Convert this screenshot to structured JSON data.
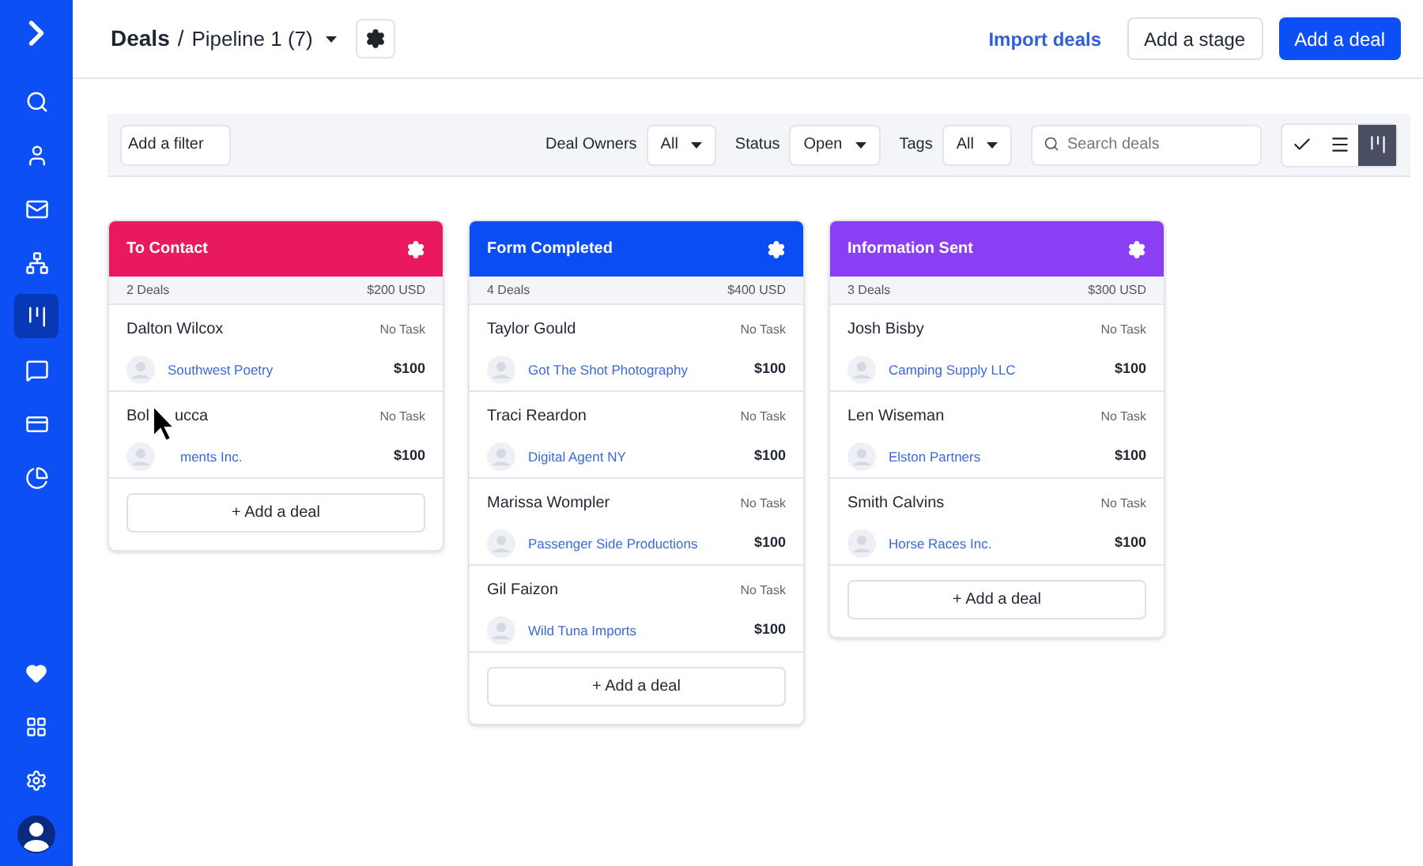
{
  "sidebar": {
    "items": [
      {
        "selected": false
      },
      {
        "selected": false
      },
      {
        "selected": false
      },
      {
        "selected": false
      },
      {
        "selected": true
      },
      {
        "selected": false
      },
      {
        "selected": false
      },
      {
        "selected": false
      }
    ]
  },
  "header": {
    "title": "Deals",
    "separator": "/",
    "pipeline": "Pipeline 1 (7)",
    "import_link": "Import deals",
    "add_stage": "Add a stage",
    "add_deal": "Add a deal"
  },
  "filters": {
    "add_filter": "Add a filter",
    "dropdowns": [
      {
        "label": "Deal Owners",
        "value": "All"
      },
      {
        "label": "Status",
        "value": "Open"
      },
      {
        "label": "Tags",
        "value": "All"
      }
    ],
    "search": {
      "placeholder": "Search deals"
    },
    "views": [
      {
        "selected": false
      },
      {
        "selected": false
      },
      {
        "selected": true
      }
    ]
  },
  "stages": [
    {
      "title": "To Contact",
      "color": "#e8195f",
      "count": "2 Deals",
      "total": "$200 USD",
      "add": "+ Add a deal",
      "deals": [
        {
          "name": "Dalton Wilcox",
          "task": "No Task",
          "company": "Southwest Poetry",
          "amount": "$100"
        },
        {
          "name": "Bol",
          "name_tail": "ucca",
          "task": "No Task",
          "company": "ments Inc.",
          "amount": "$100",
          "cursor": true
        }
      ]
    },
    {
      "title": "Form Completed",
      "color": "#0a4df2",
      "count": "4 Deals",
      "total": "$400 USD",
      "add": "+ Add a deal",
      "deals": [
        {
          "name": "Taylor Gould",
          "task": "No Task",
          "company": "Got The Shot Photography",
          "amount": "$100"
        },
        {
          "name": "Traci Reardon",
          "task": "No Task",
          "company": "Digital Agent NY",
          "amount": "$100"
        },
        {
          "name": "Marissa Wompler",
          "task": "No Task",
          "company": "Passenger Side Productions",
          "amount": "$100"
        },
        {
          "name": "Gil Faizon",
          "task": "No Task",
          "company": "Wild Tuna Imports",
          "amount": "$100"
        }
      ]
    },
    {
      "title": "Information Sent",
      "color": "#8b3ff5",
      "count": "3 Deals",
      "total": "$300 USD",
      "add": "+ Add a deal",
      "deals": [
        {
          "name": "Josh Bisby",
          "task": "No Task",
          "company": "Camping Supply LLC",
          "amount": "$100"
        },
        {
          "name": "Len Wiseman",
          "task": "No Task",
          "company": "Elston Partners",
          "amount": "$100"
        },
        {
          "name": "Smith Calvins",
          "task": "No Task",
          "company": "Horse Races Inc.",
          "amount": "$100"
        }
      ]
    }
  ]
}
